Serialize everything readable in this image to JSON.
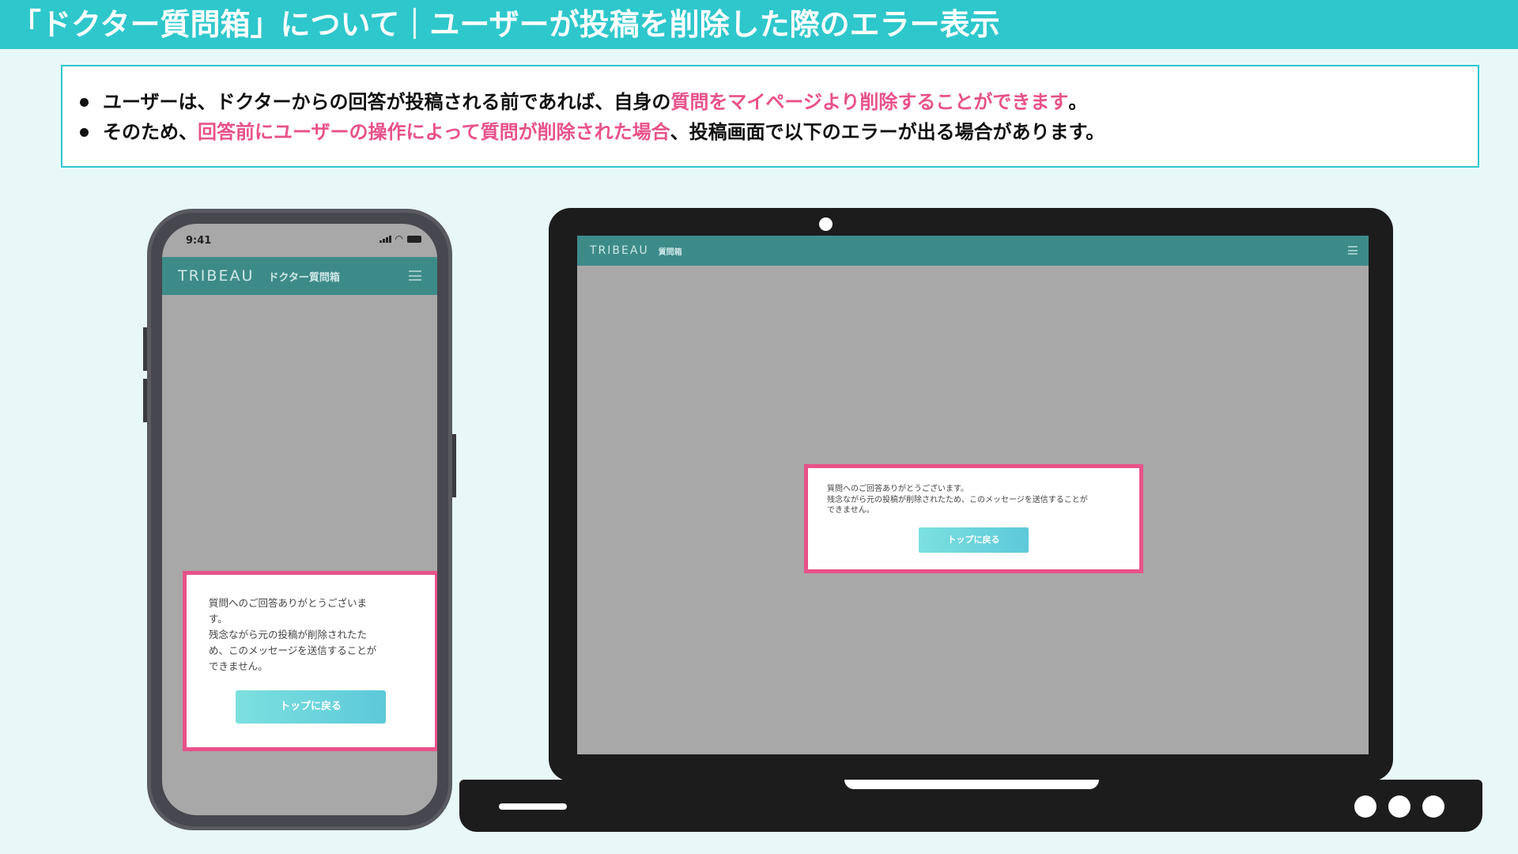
{
  "title": "「ドクター質問箱」について｜ユーザーが投稿を削除した際のエラー表示",
  "info": {
    "line1": {
      "pre": "ユーザーは、ドクターからの回答が投稿される前であれば、自身の",
      "highlight": "質問をマイページより削除することができます",
      "post": "。"
    },
    "line2": {
      "pre": "そのため、",
      "highlight": "回答前にユーザーの操作によって質問が削除された場合",
      "post": "、投稿画面で以下のエラーが出る場合があります。"
    }
  },
  "phone": {
    "time": "9:41",
    "logo": "TRIBEAU",
    "app_title": "ドクター質問箱",
    "dialog_text": "質問へのご回答ありがとうございま\nす。\n残念ながら元の投稿が削除されたた\nめ、このメッセージを送信することが\nできません。",
    "button_label": "トップに戻る"
  },
  "laptop": {
    "logo": "TRIBEAU",
    "app_title": "質問箱",
    "dialog_text": "質問へのご回答ありがとうございます。\n残念ながら元の投稿が削除されたため、このメッセージを送信することが\nできません。",
    "button_label": "トップに戻る"
  },
  "colors": {
    "title_bar": "#2ec7cc",
    "highlight": "#e8528a",
    "app_header": "#3d8b89",
    "screen_bg": "#a8a8a8"
  },
  "icons": [
    "hamburger-menu-icon",
    "signal-icon",
    "wifi-icon",
    "battery-icon",
    "camera-icon"
  ]
}
